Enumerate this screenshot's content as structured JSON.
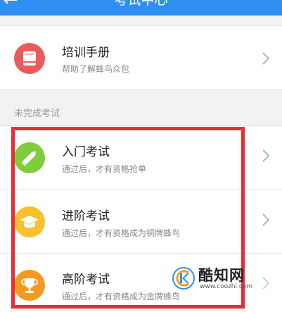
{
  "header": {
    "title": "考试中心",
    "back_glyph": "←"
  },
  "manual": {
    "title": "培训手册",
    "subtitle": "帮助了解蜂鸟众包",
    "icon": "book-icon",
    "color": "#ea5b5b"
  },
  "section": {
    "label": "未完成考试"
  },
  "exams": [
    {
      "title": "入门考试",
      "subtitle": "通过后，才有资格抢单",
      "icon": "pencil-icon",
      "color": "#7fcc3c"
    },
    {
      "title": "进阶考试",
      "subtitle": "通过后，才有资格成为铜牌蜂鸟",
      "icon": "graduation-cap-icon",
      "color": "#f7c02e"
    },
    {
      "title": "高阶考试",
      "subtitle": "通过后，才有资格成为金牌蜂鸟",
      "icon": "trophy-icon",
      "color": "#f39a23"
    }
  ],
  "watermark": {
    "name": "酷知网",
    "url": "www.coozhi.com"
  },
  "colors": {
    "header_bg": "#2f8ef2",
    "highlight": "#e62e36"
  }
}
